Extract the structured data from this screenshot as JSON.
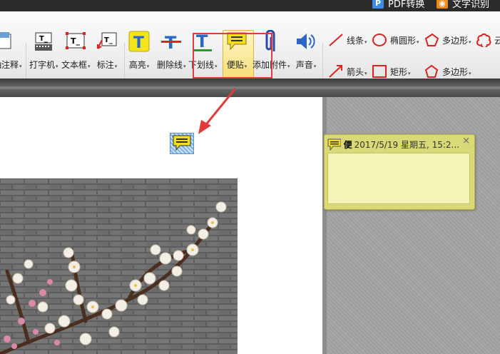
{
  "topbar": {
    "pdf_convert": "PDF转换",
    "text_recognize": "文字识别"
  },
  "toolbar": {
    "tools": [
      {
        "label": "抽注释",
        "icon": "annotation-icon"
      },
      {
        "label": "打字机",
        "icon": "typewriter-icon"
      },
      {
        "label": "文本框",
        "icon": "textbox-icon"
      },
      {
        "label": "标注",
        "icon": "callout-icon"
      },
      {
        "label": "高亮",
        "icon": "highlight-icon"
      },
      {
        "label": "删除线",
        "icon": "strikethrough-icon"
      },
      {
        "label": "下划线",
        "icon": "underline-icon"
      },
      {
        "label": "便贴",
        "icon": "sticky-note-icon"
      },
      {
        "label": "添加附件",
        "icon": "paperclip-icon"
      },
      {
        "label": "声音",
        "icon": "speaker-icon"
      }
    ],
    "shapes": [
      {
        "label": "线条",
        "icon": "line-icon"
      },
      {
        "label": "椭圆形",
        "icon": "ellipse-icon"
      },
      {
        "label": "多边形",
        "icon": "polygon-icon"
      },
      {
        "label": "云",
        "icon": "cloud-icon"
      },
      {
        "label": "箭头",
        "icon": "arrow-icon"
      },
      {
        "label": "矩形",
        "icon": "rectangle-icon"
      },
      {
        "label": "多边形",
        "icon": "polygon-icon"
      }
    ]
  },
  "note_popup": {
    "author_initial": "便",
    "timestamp": "2017/5/19 星期五, 15:2...",
    "close": "×"
  },
  "colors": {
    "highlight_red": "#e23b3b",
    "note_yellow": "#d9d978",
    "note_body": "#f4f3b8"
  }
}
